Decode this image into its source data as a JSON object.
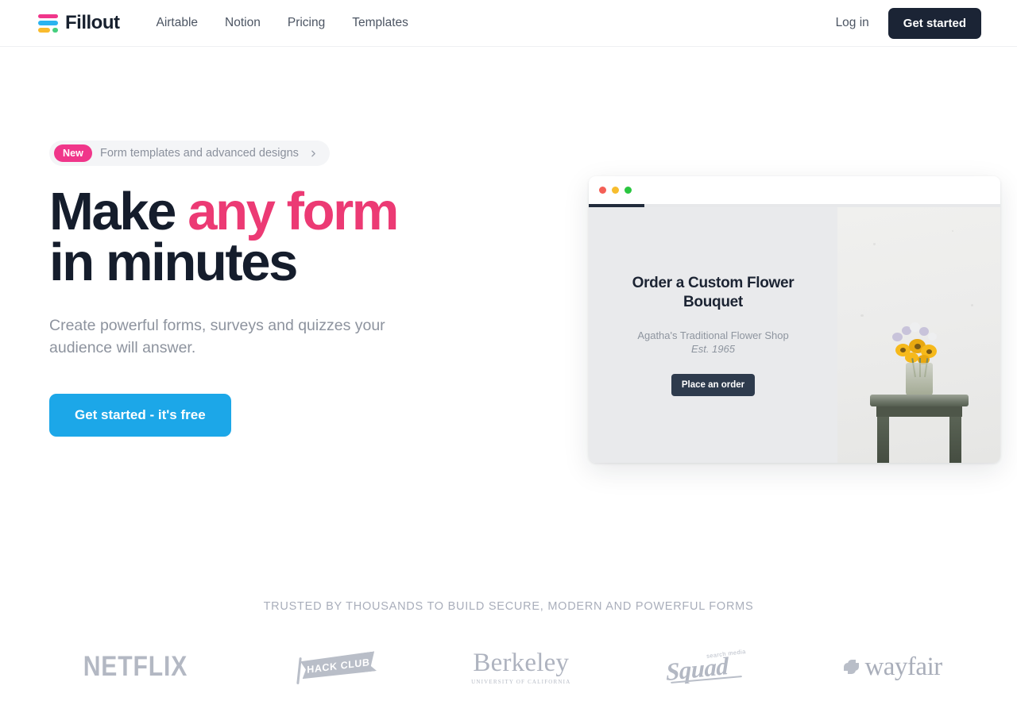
{
  "navbar": {
    "brand": {
      "name": "Fillout",
      "icon": "fillout-logo-icon"
    },
    "links": [
      {
        "label": "Airtable"
      },
      {
        "label": "Notion"
      },
      {
        "label": "Pricing"
      },
      {
        "label": "Templates"
      }
    ],
    "login_label": "Log in",
    "get_started_label": "Get started"
  },
  "hero": {
    "badge": {
      "tag": "New",
      "text": "Form templates and advanced designs",
      "chevron_icon": "chevron-right-icon"
    },
    "title_part1": "Make ",
    "title_accent": "any form",
    "title_part2": "in minutes",
    "subtitle": "Create powerful forms, surveys and quizzes your audience will answer.",
    "cta_label": "Get started - it's free"
  },
  "preview": {
    "window_dots": [
      "close-dot-red",
      "minimize-dot-yellow",
      "maximize-dot-green"
    ],
    "progress_percent": "13",
    "form": {
      "title": "Order a Custom Flower Bouquet",
      "subtitle_line1": "Agatha's Traditional Flower Shop",
      "subtitle_line2": "Est. 1965",
      "button_label": "Place an order"
    },
    "photo_alt": "sunflowers-in-jar-on-stool-photo"
  },
  "thumbnails": {
    "items": [
      {
        "name": "layout-plain",
        "selected": false
      },
      {
        "name": "layout-header-block",
        "selected": false
      },
      {
        "name": "layout-image",
        "selected": false
      },
      {
        "name": "layout-left-sidebar",
        "selected": false
      },
      {
        "name": "layout-yellow-split",
        "selected": true
      },
      {
        "name": "layout-framed",
        "selected": false
      }
    ]
  },
  "trusted": {
    "label": "Trusted by thousands to build secure, modern and powerful forms",
    "logos": [
      {
        "name": "netflix-logo",
        "text": "NETFLIX"
      },
      {
        "name": "hack-club-logo",
        "text": "HACK CLUB"
      },
      {
        "name": "berkeley-logo",
        "text": "Berkeley",
        "sub": "UNIVERSITY OF CALIFORNIA"
      },
      {
        "name": "search-media-squad-logo",
        "text": "Squad",
        "sub": "search media"
      },
      {
        "name": "wayfair-logo",
        "text": "wayfair"
      }
    ]
  },
  "colors": {
    "accent_pink": "#ec3a74",
    "cta_blue": "#1ca7e8",
    "dark": "#1b2435",
    "selected_thumb": "#f2b824"
  }
}
